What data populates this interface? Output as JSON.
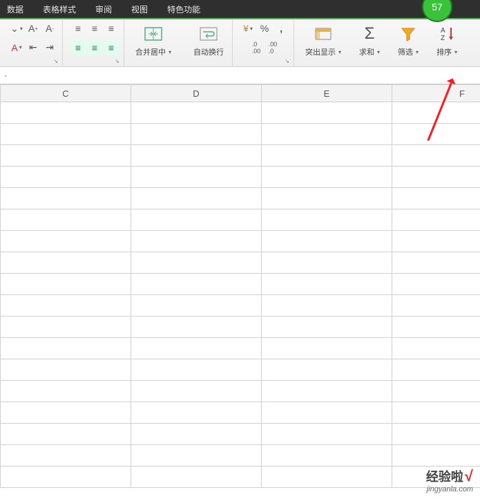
{
  "menu": {
    "items": [
      "数据",
      "表格样式",
      "审阅",
      "视图",
      "特色功能"
    ],
    "badge": "57"
  },
  "ribbon": {
    "font": {
      "inc": "A↑",
      "dec": "A↓"
    },
    "align": {},
    "merge": {
      "label": "合并居中"
    },
    "wrap": {
      "label": "自动换行"
    },
    "number": {
      "pct": "%",
      "comma": ",",
      "inc": ".0←",
      "dec": "→.0"
    },
    "highlight": {
      "label": "突出显示"
    },
    "sum": {
      "label": "求和"
    },
    "filter": {
      "label": "筛选"
    },
    "sort": {
      "label": "排序"
    }
  },
  "formula": {
    "value": "-"
  },
  "columns": [
    "C",
    "D",
    "E",
    "F"
  ],
  "watermark": {
    "title": "经验啦",
    "check": "√",
    "url": "jingyanla.com"
  }
}
